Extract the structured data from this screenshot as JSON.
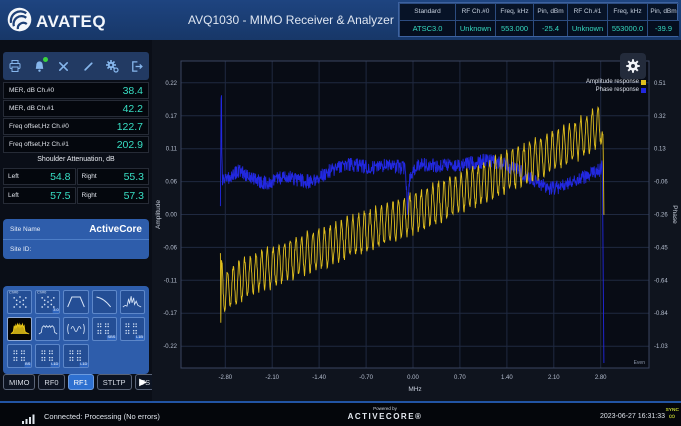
{
  "header": {
    "brand": "AVATEQ",
    "title": "AVQ1030 - MIMO Receiver & Analyzer",
    "status_table": {
      "headers": [
        "Standard",
        "RF Ch.#0",
        "Freq, kHz",
        "Pin, dBm",
        "RF Ch.#1",
        "Freq, kHz",
        "Pin, dBm"
      ],
      "values": [
        "ATSC3.0",
        "Unknown",
        "553.000",
        "-25.4",
        "Unknown",
        "553000.0",
        "-39.9"
      ]
    }
  },
  "sidebar": {
    "measurements": [
      {
        "label": "MER, dB Ch.#0",
        "value": "38.4"
      },
      {
        "label": "MER, dB Ch.#1",
        "value": "42.2"
      },
      {
        "label": "Freq offset,Hz Ch.#0",
        "value": "122.7"
      },
      {
        "label": "Freq offset,Hz Ch.#1",
        "value": "202.9"
      }
    ],
    "shoulder": {
      "title": "Shoulder Attenuation, dB",
      "rows": [
        {
          "cells": [
            {
              "label": "Left",
              "value": "54.8"
            },
            {
              "label": "Right",
              "value": "55.3"
            }
          ]
        },
        {
          "cells": [
            {
              "label": "Left",
              "value": "57.5"
            },
            {
              "label": "Right",
              "value": "57.3"
            }
          ]
        }
      ]
    },
    "site": {
      "name_label": "Site Name",
      "name_value": "ActiveCore",
      "id_label": "Site ID:",
      "id_value": ""
    },
    "view_tiles": [
      {
        "name": "constellation-ch0",
        "glyph": "constellation",
        "top": "Ch#0"
      },
      {
        "name": "constellation-atsc3",
        "glyph": "constellation",
        "top": "Ch#0",
        "br": "3.0"
      },
      {
        "name": "channel-mask",
        "glyph": "trapezoid"
      },
      {
        "name": "rolloff-curve",
        "glyph": "curve"
      },
      {
        "name": "spectrum-peaks",
        "glyph": "spectrum"
      },
      {
        "name": "spectrum-shoulders",
        "glyph": "shoulders",
        "active": true
      },
      {
        "name": "spectrum-shoulders-alt",
        "glyph": "shoulders2"
      },
      {
        "name": "impulse-response",
        "glyph": "wave"
      },
      {
        "name": "qam-grid-sbs",
        "glyph": "qam",
        "br": "SBS"
      },
      {
        "name": "qam-grid-l1b",
        "glyph": "qam",
        "br": "L1B"
      },
      {
        "name": "qam-grid-bs",
        "glyph": "qam",
        "br": "BS"
      },
      {
        "name": "qam-grid-l1d",
        "glyph": "qam",
        "br": "L1D"
      },
      {
        "name": "qam-grid-l1d2",
        "glyph": "qam",
        "br": "L1D"
      }
    ],
    "tabs": [
      {
        "label": "MIMO",
        "active": false
      },
      {
        "label": "RF0",
        "active": false
      },
      {
        "label": "RF1",
        "active": true
      },
      {
        "label": "STLTP",
        "active": false
      },
      {
        "label": "TS",
        "active": false
      }
    ]
  },
  "chart_data": {
    "type": "line",
    "xlabel": "MHz",
    "xlim": [
      -3.46,
      3.52
    ],
    "ylim": [
      -0.2565,
      0.2565
    ],
    "x_ticks": [
      {
        "v": -2.8,
        "label": "-2.80"
      },
      {
        "v": -2.1,
        "label": "-2.10"
      },
      {
        "v": -1.4,
        "label": "-1.40"
      },
      {
        "v": -0.7,
        "label": "-0.70"
      },
      {
        "v": 0,
        "label": "0.00"
      },
      {
        "v": 0.7,
        "label": "0.70"
      },
      {
        "v": 1.4,
        "label": "1.40"
      },
      {
        "v": 2.1,
        "label": "2.10"
      },
      {
        "v": 2.8,
        "label": "2.80"
      }
    ],
    "left_axis": {
      "label": "Amplitude",
      "ticks": [
        {
          "v": 0.22,
          "label": "0.22"
        },
        {
          "v": 0.165,
          "label": "0.17"
        },
        {
          "v": 0.11,
          "label": "0.11"
        },
        {
          "v": 0.055,
          "label": "0.06"
        },
        {
          "v": 0,
          "label": "0.00"
        },
        {
          "v": -0.055,
          "label": "-0.06"
        },
        {
          "v": -0.11,
          "label": "-0.11"
        },
        {
          "v": -0.165,
          "label": "-0.17"
        },
        {
          "v": -0.22,
          "label": "-0.22"
        }
      ]
    },
    "right_axis": {
      "label": "Phase",
      "ticks": [
        {
          "v": 0.22,
          "label": "0.51"
        },
        {
          "v": 0.165,
          "label": "0.32"
        },
        {
          "v": 0.11,
          "label": "0.13"
        },
        {
          "v": 0.055,
          "label": "-0.06"
        },
        {
          "v": 0,
          "label": "-0.26"
        },
        {
          "v": -0.055,
          "label": "-0.45"
        },
        {
          "v": -0.11,
          "label": "-0.64"
        },
        {
          "v": -0.165,
          "label": "-0.84"
        },
        {
          "v": -0.22,
          "label": "-1.03"
        }
      ]
    },
    "legend": [
      {
        "label": "Amplitude response",
        "color": "#e2c01d"
      },
      {
        "label": "Phase response",
        "color": "#2228e0"
      }
    ],
    "corner_note": "Even",
    "series": [
      {
        "name": "Amplitude response",
        "color": "#e2c01d",
        "seed": 0,
        "samples": 1100,
        "domain": [
          -2.872,
          2.848
        ],
        "ripple": {
          "period": 0.085,
          "amp": 0.032
        },
        "noise": 0.006,
        "keypoints": [
          [
            -2.872,
            -0.06
          ],
          [
            -2.866,
            -0.22
          ],
          [
            -2.858,
            -0.1
          ],
          [
            -2.83,
            -0.13
          ],
          [
            -2.7,
            -0.12
          ],
          [
            -2.5,
            -0.105
          ],
          [
            -2.3,
            -0.095
          ],
          [
            -2.1,
            -0.088
          ],
          [
            -1.9,
            -0.078
          ],
          [
            -1.7,
            -0.068
          ],
          [
            -1.5,
            -0.062
          ],
          [
            -1.3,
            -0.055
          ],
          [
            -1.1,
            -0.045
          ],
          [
            -0.9,
            -0.035
          ],
          [
            -0.7,
            -0.028
          ],
          [
            -0.5,
            -0.02
          ],
          [
            -0.3,
            -0.012
          ],
          [
            -0.1,
            -0.003
          ],
          [
            0.1,
            0.006
          ],
          [
            0.3,
            0.016
          ],
          [
            0.5,
            0.026
          ],
          [
            0.7,
            0.036
          ],
          [
            0.9,
            0.046
          ],
          [
            1.1,
            0.056
          ],
          [
            1.3,
            0.066
          ],
          [
            1.5,
            0.076
          ],
          [
            1.7,
            0.086
          ],
          [
            1.9,
            0.096
          ],
          [
            2.1,
            0.106
          ],
          [
            2.3,
            0.116
          ],
          [
            2.5,
            0.128
          ],
          [
            2.65,
            0.138
          ],
          [
            2.78,
            0.148
          ],
          [
            2.82,
            0.152
          ],
          [
            2.836,
            0.1
          ],
          [
            2.848,
            -0.03
          ]
        ]
      },
      {
        "name": "Phase response",
        "color": "#2228e0",
        "seed": 500,
        "samples": 1100,
        "domain": [
          -2.872,
          2.848
        ],
        "ripple": null,
        "noise": 0.012,
        "keypoints": [
          [
            -2.872,
            0.02
          ],
          [
            -2.864,
            0.16
          ],
          [
            -2.858,
            0.235
          ],
          [
            -2.85,
            0.09
          ],
          [
            -2.84,
            0.055
          ],
          [
            -2.75,
            0.062
          ],
          [
            -2.6,
            0.072
          ],
          [
            -2.45,
            0.065
          ],
          [
            -2.3,
            0.055
          ],
          [
            -2.15,
            0.052
          ],
          [
            -2.0,
            0.06
          ],
          [
            -1.85,
            0.062
          ],
          [
            -1.7,
            0.058
          ],
          [
            -1.55,
            0.055
          ],
          [
            -1.4,
            0.062
          ],
          [
            -1.25,
            0.072
          ],
          [
            -1.1,
            0.078
          ],
          [
            -0.95,
            0.084
          ],
          [
            -0.8,
            0.082
          ],
          [
            -0.65,
            0.078
          ],
          [
            -0.5,
            0.08
          ],
          [
            -0.35,
            0.082
          ],
          [
            -0.2,
            0.08
          ],
          [
            -0.12,
            0.078
          ],
          [
            -0.08,
            0.01
          ],
          [
            -0.04,
            0.07
          ],
          [
            0.1,
            0.082
          ],
          [
            0.25,
            0.084
          ],
          [
            0.4,
            0.08
          ],
          [
            0.55,
            0.084
          ],
          [
            0.7,
            0.082
          ],
          [
            0.85,
            0.086
          ],
          [
            1.0,
            0.088
          ],
          [
            1.15,
            0.09
          ],
          [
            1.3,
            0.086
          ],
          [
            1.45,
            0.08
          ],
          [
            1.6,
            0.072
          ],
          [
            1.75,
            0.06
          ],
          [
            1.9,
            0.05
          ],
          [
            2.05,
            0.044
          ],
          [
            2.2,
            0.046
          ],
          [
            2.35,
            0.052
          ],
          [
            2.5,
            0.06
          ],
          [
            2.65,
            0.068
          ],
          [
            2.75,
            0.072
          ],
          [
            2.8,
            0.075
          ],
          [
            2.825,
            0.09
          ],
          [
            2.835,
            -0.08
          ],
          [
            2.848,
            -0.24
          ]
        ]
      }
    ]
  },
  "statusbar": {
    "connection": "Connected: Processing (No errors)",
    "powered_by": "Powered by",
    "brand": "ACTIVECORE®",
    "timestamp": "2023-06-27 16:31:33",
    "sync_label": "SYNC",
    "sync_glyph": "∞"
  }
}
